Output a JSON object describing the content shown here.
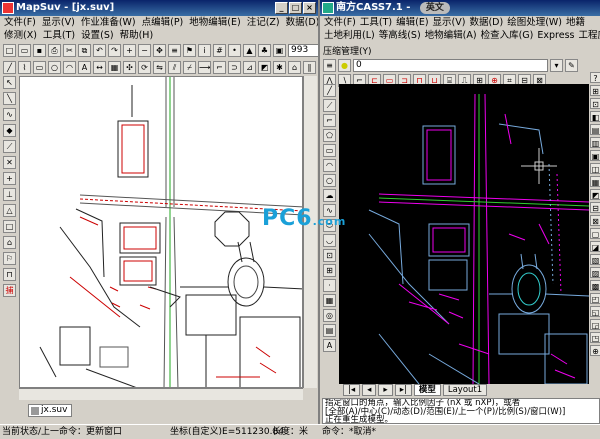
{
  "left": {
    "title": "MapSuv - [jx.suv]",
    "menu1": [
      "文件(F)",
      "显示(V)",
      "作业准备(W)",
      "点编辑(P)",
      "地物编辑(E)",
      "注记(Z)",
      "数据(D)"
    ],
    "menu2": [
      "修测(X)",
      "工具(T)",
      "设置(S)",
      "帮助(H)"
    ],
    "scale_value": "993",
    "read_label": "读",
    "doc_tab": "jx.suv",
    "status": "当前状态/上一命令：更新窗口",
    "status_coords": "坐标(自定义)E=511230.84",
    "status_length": "长度：米",
    "status_unit": "单位"
  },
  "right": {
    "title": "南方CASS7.1 -",
    "title_badge": "英文",
    "menu1": [
      "文件(F)",
      "工具(T)",
      "编辑(E)",
      "显示(V)",
      "数据(D)",
      "绘图处理(W)",
      "地籍"
    ],
    "menu2": [
      "土地利用(L)",
      "等高线(S)",
      "地物编辑(A)",
      "检查入库(G)",
      "Express",
      "工程应用(C)"
    ],
    "toolbar_label": "压缩管理(Y)",
    "layer_value": "0",
    "tabs": [
      "模型",
      "Layout1"
    ],
    "command_lines": [
      "指定窗口的角点，输入比例因子 (nX 或 nXP)，或者",
      "[全部(A)/中心(C)/动态(D)/范围(E)/上一个(P)/比例(S)/窗口(W)]",
      "正在重生成模型。",
      "命令：*取消*"
    ]
  },
  "watermark": {
    "main": "PC6",
    "small": ".com"
  }
}
